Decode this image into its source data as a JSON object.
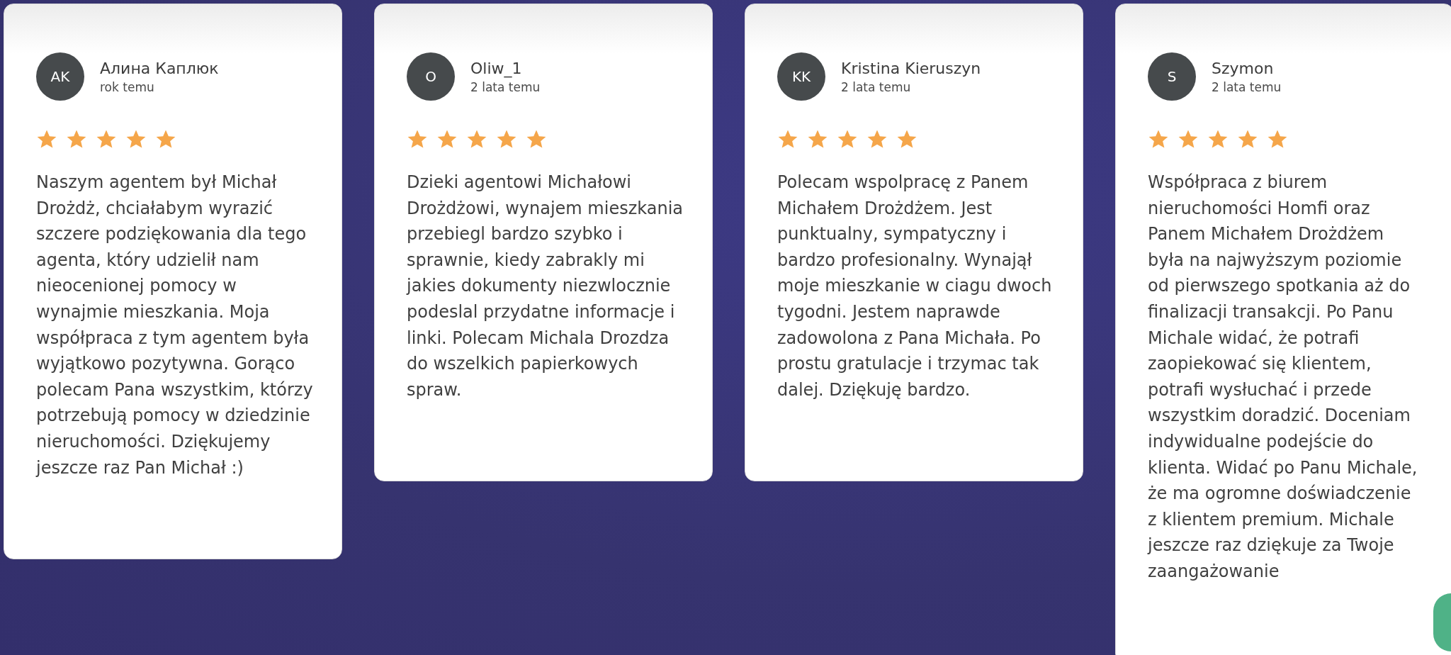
{
  "reviews": [
    {
      "initials": "AK",
      "name": "Алина Каплюк",
      "time": "rok temu",
      "stars": 5,
      "text": "Naszym agentem był Michał Drożdż, chciałabym wyrazić szczere podziękowania dla tego agenta, który udzielił nam nieocenionej pomocy w wynajmie mieszkania. Moja współpraca z tym agentem była wyjątkowo pozytywna. Gorąco polecam Pana wszystkim, którzy potrzebują pomocy w dziedzinie nieruchomości. Dziękujemy jeszcze raz Pan Michał :)"
    },
    {
      "initials": "O",
      "name": "Oliw_1",
      "time": "2 lata temu",
      "stars": 5,
      "text": "Dzieki agentowi Michałowi Drożdżowi, wynajem mieszkania przebiegl bardzo szybko i sprawnie, kiedy zabrakly mi jakies dokumenty niezwlocznie podeslal przydatne informacje i linki. Polecam Michala Drozdza do wszelkich papierkowych spraw."
    },
    {
      "initials": "KK",
      "name": "Kristina Kieruszyn",
      "time": "2 lata temu",
      "stars": 5,
      "text": "Polecam wspolpracę z Panem Michałem Drożdżem. Jest punktualny, sympatyczny i bardzo profesionalny. Wynajął moje mieszkanie w ciagu dwoch tygodni. Jestem naprawde zadowolona z Pana Michała. Po prostu gratulacje i trzymac tak dalej. Dziękuję bardzo."
    },
    {
      "initials": "S",
      "name": "Szymon",
      "time": "2 lata temu",
      "stars": 5,
      "text": "Współpraca z biurem nieruchomości Homfi oraz Panem Michałem Drożdżem była na najwyższym poziomie od pierwszego spotkania aż do finalizacji transakcji. Po Panu Michale widać, że potrafi zaopiekować się klientem, potrafi wysłuchać i przede wszystkim doradzić. Doceniam indywidualne podejście do klienta. Widać po Panu Michale, że ma ogromne doświadczenie z klientem premium. Michale jeszcze raz dziękuje za Twoje zaangażowanie"
    }
  ]
}
